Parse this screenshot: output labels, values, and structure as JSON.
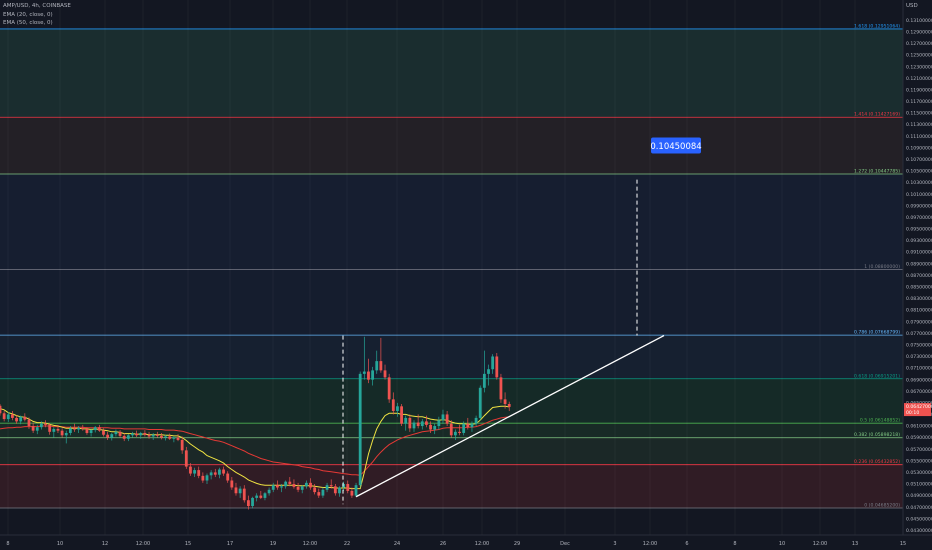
{
  "header": {
    "symbol": "AMP/USD, 4h, COINBASE",
    "ema1": "EMA (20, close, 0)",
    "ema2": "EMA (50, close, 0)"
  },
  "currency": "USD",
  "colors": {
    "background": "#131722",
    "up": "#26a69a",
    "down": "#ef5350",
    "ema20": "#f0e442",
    "ema50": "#e53935",
    "trendline": "#ffffff",
    "callout": "#2962ff"
  },
  "chart_data": {
    "type": "candlestick",
    "y_axis": {
      "scale": "linear",
      "range": [
        0.0422,
        0.1345
      ],
      "ticks": [
        "0.13300000",
        "0.13100000",
        "0.12900000",
        "0.12700000",
        "0.12500000",
        "0.12300000",
        "0.12100000",
        "0.11900000",
        "0.11700000",
        "0.11500000",
        "0.11300000",
        "0.11100000",
        "0.10900000",
        "0.10700000",
        "0.10500000",
        "0.10300000",
        "0.10100000",
        "0.09900000",
        "0.09700000",
        "0.09500000",
        "0.09300000",
        "0.09100000",
        "0.08900000",
        "0.08700000",
        "0.08500000",
        "0.08300000",
        "0.08100000",
        "0.07900000",
        "0.07700000",
        "0.07500000",
        "0.07300000",
        "0.07100000",
        "0.06900000",
        "0.06700000",
        "0.06500000",
        "0.06300000",
        "0.06100000",
        "0.05900000",
        "0.05700000",
        "0.05500000",
        "0.05300000",
        "0.05100000",
        "0.04900000",
        "0.04700000",
        "0.04500000",
        "0.04300000"
      ]
    },
    "x_axis": {
      "tick_labels": [
        "8",
        "10",
        "12",
        "12:00",
        "15",
        "17",
        "19",
        "12:00",
        "22",
        "24",
        "26",
        "12:00",
        "29",
        "Dec",
        "3",
        "12:00",
        "6",
        "8",
        "10",
        "12:00",
        "13",
        "15"
      ]
    },
    "last_price": "0.06427000",
    "countdown": "00:10",
    "fib_levels": [
      {
        "label": "0 (0.04685200)",
        "value": 0.046852,
        "color": "#787b86"
      },
      {
        "label": "0.236 (0.05432852)",
        "value": 0.05432852,
        "color": "#f23645"
      },
      {
        "label": "0.382 (0.05898218)",
        "value": 0.05898218,
        "color": "#81c784"
      },
      {
        "label": "0.5 (0.06148852)",
        "value": 0.06148852,
        "color": "#4caf50"
      },
      {
        "label": "0.618 (0.06915201)",
        "value": 0.06915201,
        "color": "#089981"
      },
      {
        "label": "0.786 (0.07668799)",
        "value": 0.07668799,
        "color": "#64b5f6"
      },
      {
        "label": "1 (0.08800000)",
        "value": 0.088,
        "color": "#787b86"
      },
      {
        "label": "1.272 (0.10447785)",
        "value": 0.10447785,
        "color": "#81c784"
      },
      {
        "label": "1.414 (0.11427169)",
        "value": 0.11427169,
        "color": "#f23645"
      },
      {
        "label": "1.618 (0.12951064)",
        "value": 0.12951064,
        "color": "#2196f3"
      }
    ],
    "target_price": "0.10450084",
    "candles": [
      [
        0.0645,
        0.0648,
        0.0628,
        0.0632
      ],
      [
        0.0632,
        0.0636,
        0.0618,
        0.0622
      ],
      [
        0.0622,
        0.0634,
        0.0617,
        0.063
      ],
      [
        0.063,
        0.0636,
        0.062,
        0.0624
      ],
      [
        0.0624,
        0.0629,
        0.0614,
        0.0618
      ],
      [
        0.0618,
        0.0628,
        0.0613,
        0.0626
      ],
      [
        0.0626,
        0.0632,
        0.0618,
        0.0621
      ],
      [
        0.0621,
        0.0625,
        0.0605,
        0.061
      ],
      [
        0.061,
        0.0616,
        0.0598,
        0.0602
      ],
      [
        0.0602,
        0.0612,
        0.0596,
        0.0608
      ],
      [
        0.0608,
        0.0618,
        0.0604,
        0.0614
      ],
      [
        0.0614,
        0.062,
        0.0608,
        0.0612
      ],
      [
        0.0612,
        0.0615,
        0.0595,
        0.06
      ],
      [
        0.06,
        0.0608,
        0.059,
        0.0605
      ],
      [
        0.0605,
        0.0612,
        0.0598,
        0.0602
      ],
      [
        0.0602,
        0.0606,
        0.059,
        0.0594
      ],
      [
        0.0594,
        0.0602,
        0.058,
        0.0598
      ],
      [
        0.0598,
        0.061,
        0.0594,
        0.0606
      ],
      [
        0.0606,
        0.0614,
        0.06,
        0.0604
      ],
      [
        0.0604,
        0.061,
        0.0598,
        0.0607
      ],
      [
        0.0607,
        0.0612,
        0.0602,
        0.0605
      ],
      [
        0.0605,
        0.0608,
        0.0595,
        0.0598
      ],
      [
        0.0598,
        0.0606,
        0.0592,
        0.0603
      ],
      [
        0.0603,
        0.061,
        0.0599,
        0.0608
      ],
      [
        0.0608,
        0.0612,
        0.06,
        0.0602
      ],
      [
        0.0602,
        0.0606,
        0.0592,
        0.0595
      ],
      [
        0.0595,
        0.06,
        0.0586,
        0.059
      ],
      [
        0.059,
        0.0598,
        0.0585,
        0.0596
      ],
      [
        0.0596,
        0.0604,
        0.0592,
        0.06
      ],
      [
        0.06,
        0.0603,
        0.059,
        0.0593
      ],
      [
        0.0593,
        0.0598,
        0.0584,
        0.0588
      ],
      [
        0.0588,
        0.0596,
        0.0584,
        0.0594
      ],
      [
        0.0594,
        0.06,
        0.059,
        0.0597
      ],
      [
        0.0597,
        0.0602,
        0.0591,
        0.0594
      ],
      [
        0.0594,
        0.06,
        0.0588,
        0.0598
      ],
      [
        0.0598,
        0.0603,
        0.0592,
        0.0595
      ],
      [
        0.0595,
        0.06,
        0.0588,
        0.0592
      ],
      [
        0.0592,
        0.0598,
        0.0586,
        0.0595
      ],
      [
        0.0595,
        0.06,
        0.059,
        0.0593
      ],
      [
        0.0593,
        0.0598,
        0.0587,
        0.059
      ],
      [
        0.059,
        0.0595,
        0.0585,
        0.0592
      ],
      [
        0.0592,
        0.0597,
        0.0586,
        0.0588
      ],
      [
        0.0588,
        0.0593,
        0.0582,
        0.059
      ],
      [
        0.059,
        0.0596,
        0.0584,
        0.0586
      ],
      [
        0.0586,
        0.0592,
        0.0562,
        0.0568
      ],
      [
        0.0568,
        0.0574,
        0.0536,
        0.054
      ],
      [
        0.054,
        0.0546,
        0.0524,
        0.0528
      ],
      [
        0.0528,
        0.0538,
        0.0522,
        0.0534
      ],
      [
        0.0534,
        0.054,
        0.052,
        0.0524
      ],
      [
        0.0524,
        0.053,
        0.0512,
        0.0516
      ],
      [
        0.0516,
        0.0528,
        0.051,
        0.0525
      ],
      [
        0.0525,
        0.0534,
        0.0518,
        0.053
      ],
      [
        0.053,
        0.0536,
        0.0522,
        0.0526
      ],
      [
        0.0526,
        0.0538,
        0.052,
        0.0535
      ],
      [
        0.0535,
        0.054,
        0.0524,
        0.0528
      ],
      [
        0.0528,
        0.0532,
        0.0512,
        0.0516
      ],
      [
        0.0516,
        0.0522,
        0.05,
        0.0504
      ],
      [
        0.0504,
        0.0512,
        0.049,
        0.0494
      ],
      [
        0.0494,
        0.0506,
        0.0486,
        0.0502
      ],
      [
        0.0502,
        0.0508,
        0.0478,
        0.0482
      ],
      [
        0.0482,
        0.049,
        0.0466,
        0.0472
      ],
      [
        0.0472,
        0.0488,
        0.0468,
        0.0486
      ],
      [
        0.0486,
        0.0494,
        0.048,
        0.049
      ],
      [
        0.049,
        0.0498,
        0.0484,
        0.0486
      ],
      [
        0.0486,
        0.0496,
        0.0482,
        0.0494
      ],
      [
        0.0494,
        0.0504,
        0.049,
        0.05
      ],
      [
        0.05,
        0.0512,
        0.0496,
        0.0508
      ],
      [
        0.0508,
        0.0516,
        0.05,
        0.0504
      ],
      [
        0.0504,
        0.051,
        0.0496,
        0.0506
      ],
      [
        0.0506,
        0.0516,
        0.0502,
        0.0514
      ],
      [
        0.0514,
        0.0522,
        0.0506,
        0.051
      ],
      [
        0.051,
        0.0518,
        0.0502,
        0.0505
      ],
      [
        0.0505,
        0.0512,
        0.0496,
        0.05
      ],
      [
        0.05,
        0.0508,
        0.0494,
        0.0506
      ],
      [
        0.0506,
        0.0516,
        0.0502,
        0.0512
      ],
      [
        0.0512,
        0.052,
        0.05,
        0.0504
      ],
      [
        0.0504,
        0.051,
        0.0492,
        0.0496
      ],
      [
        0.0496,
        0.0502,
        0.0486,
        0.049
      ],
      [
        0.049,
        0.0504,
        0.0486,
        0.05
      ],
      [
        0.05,
        0.0512,
        0.0496,
        0.0508
      ],
      [
        0.0508,
        0.0518,
        0.0502,
        0.0506
      ],
      [
        0.0506,
        0.051,
        0.049,
        0.0494
      ],
      [
        0.0494,
        0.0506,
        0.0488,
        0.0504
      ],
      [
        0.0504,
        0.0514,
        0.0498,
        0.051
      ],
      [
        0.051,
        0.0516,
        0.0494,
        0.0498
      ],
      [
        0.0498,
        0.0504,
        0.0486,
        0.049
      ],
      [
        0.049,
        0.0512,
        0.0488,
        0.0508
      ],
      [
        0.0508,
        0.0704,
        0.0504,
        0.07
      ],
      [
        0.07,
        0.0764,
        0.069,
        0.0704
      ],
      [
        0.0704,
        0.0726,
        0.0684,
        0.069
      ],
      [
        0.069,
        0.0712,
        0.068,
        0.0706
      ],
      [
        0.0706,
        0.074,
        0.07,
        0.0722
      ],
      [
        0.0722,
        0.0762,
        0.0702,
        0.0706
      ],
      [
        0.0706,
        0.0716,
        0.069,
        0.0694
      ],
      [
        0.0694,
        0.07,
        0.065,
        0.0656
      ],
      [
        0.0656,
        0.0668,
        0.063,
        0.0636
      ],
      [
        0.0636,
        0.065,
        0.0626,
        0.0644
      ],
      [
        0.0644,
        0.0648,
        0.061,
        0.0614
      ],
      [
        0.0614,
        0.0628,
        0.0602,
        0.0624
      ],
      [
        0.0624,
        0.063,
        0.06,
        0.0606
      ],
      [
        0.0606,
        0.062,
        0.06,
        0.0616
      ],
      [
        0.0616,
        0.063,
        0.0606,
        0.061
      ],
      [
        0.061,
        0.0622,
        0.0604,
        0.0618
      ],
      [
        0.0618,
        0.0628,
        0.0608,
        0.0612
      ],
      [
        0.0612,
        0.0618,
        0.0598,
        0.0604
      ],
      [
        0.0604,
        0.0614,
        0.0596,
        0.061
      ],
      [
        0.061,
        0.0626,
        0.0604,
        0.062
      ],
      [
        0.062,
        0.0638,
        0.0614,
        0.063
      ],
      [
        0.063,
        0.0636,
        0.061,
        0.0614
      ],
      [
        0.0614,
        0.062,
        0.059,
        0.0594
      ],
      [
        0.0594,
        0.0604,
        0.0586,
        0.06
      ],
      [
        0.06,
        0.0612,
        0.0594,
        0.0598
      ],
      [
        0.0598,
        0.0618,
        0.0594,
        0.0614
      ],
      [
        0.0614,
        0.0624,
        0.0604,
        0.0608
      ],
      [
        0.0608,
        0.0618,
        0.06,
        0.0614
      ],
      [
        0.0614,
        0.0628,
        0.061,
        0.0624
      ],
      [
        0.0624,
        0.068,
        0.062,
        0.0676
      ],
      [
        0.0676,
        0.074,
        0.0668,
        0.07
      ],
      [
        0.07,
        0.0716,
        0.068,
        0.0708
      ],
      [
        0.0708,
        0.0734,
        0.07,
        0.073
      ],
      [
        0.073,
        0.0736,
        0.069,
        0.0694
      ],
      [
        0.0694,
        0.07,
        0.065,
        0.0656
      ],
      [
        0.0656,
        0.0668,
        0.064,
        0.0648
      ],
      [
        0.0648,
        0.0652,
        0.0636,
        0.0643
      ]
    ],
    "ema20": [
      0.064,
      0.0638,
      0.0633,
      0.0631,
      0.0628,
      0.0626,
      0.0625,
      0.0622,
      0.0618,
      0.0616,
      0.0616,
      0.0615,
      0.0613,
      0.0611,
      0.061,
      0.0608,
      0.0606,
      0.0606,
      0.0606,
      0.0606,
      0.0605,
      0.0605,
      0.0604,
      0.0605,
      0.0604,
      0.0603,
      0.0602,
      0.06,
      0.06,
      0.0599,
      0.0597,
      0.0597,
      0.0597,
      0.0596,
      0.0596,
      0.0596,
      0.0595,
      0.0595,
      0.0595,
      0.0595,
      0.0594,
      0.0594,
      0.0593,
      0.0593,
      0.059,
      0.0585,
      0.0579,
      0.0574,
      0.0569,
      0.0565,
      0.0559,
      0.0556,
      0.0553,
      0.055,
      0.0546,
      0.054,
      0.0535,
      0.053,
      0.0526,
      0.0522,
      0.0517,
      0.0514,
      0.0511,
      0.0509,
      0.0508,
      0.0508,
      0.0508,
      0.0508,
      0.0508,
      0.0508,
      0.0508,
      0.0508,
      0.0507,
      0.0507,
      0.0507,
      0.0507,
      0.0506,
      0.0505,
      0.0504,
      0.0504,
      0.0504,
      0.0503,
      0.0503,
      0.0503,
      0.0503,
      0.0502,
      0.0502,
      0.0502,
      0.053,
      0.0562,
      0.0585,
      0.0605,
      0.0618,
      0.0628,
      0.0632,
      0.0632,
      0.0632,
      0.063,
      0.063,
      0.0628,
      0.0627,
      0.0626,
      0.0626,
      0.0624,
      0.0622,
      0.0621,
      0.062,
      0.0621,
      0.062,
      0.0617,
      0.0615,
      0.0614,
      0.0614,
      0.0613,
      0.0613,
      0.0614,
      0.062,
      0.0628,
      0.0635,
      0.0642,
      0.0643,
      0.0644,
      0.0644,
      0.0643
    ],
    "ema50": [
      0.0605,
      0.0606,
      0.0607,
      0.0607,
      0.0608,
      0.0608,
      0.0609,
      0.0609,
      0.0609,
      0.0609,
      0.061,
      0.061,
      0.061,
      0.0609,
      0.0609,
      0.0609,
      0.0608,
      0.0608,
      0.0608,
      0.0608,
      0.0608,
      0.0607,
      0.0607,
      0.0607,
      0.0607,
      0.0607,
      0.0607,
      0.0606,
      0.0606,
      0.0606,
      0.0605,
      0.0605,
      0.0605,
      0.0605,
      0.0605,
      0.0605,
      0.0604,
      0.0604,
      0.0604,
      0.0604,
      0.0603,
      0.0603,
      0.0603,
      0.0602,
      0.0601,
      0.0599,
      0.0597,
      0.0595,
      0.0593,
      0.0591,
      0.0589,
      0.0587,
      0.0585,
      0.0584,
      0.0582,
      0.0579,
      0.0576,
      0.0573,
      0.057,
      0.0567,
      0.0563,
      0.056,
      0.0557,
      0.0554,
      0.0552,
      0.055,
      0.0548,
      0.0547,
      0.0546,
      0.0545,
      0.0544,
      0.0543,
      0.0542,
      0.054,
      0.0539,
      0.0538,
      0.0536,
      0.0535,
      0.0533,
      0.0532,
      0.0531,
      0.053,
      0.0529,
      0.0528,
      0.0527,
      0.0526,
      0.0526,
      0.0525,
      0.0532,
      0.054,
      0.0548,
      0.0557,
      0.0565,
      0.0572,
      0.0578,
      0.0582,
      0.0586,
      0.0589,
      0.0592,
      0.0594,
      0.0596,
      0.0598,
      0.06,
      0.0601,
      0.0602,
      0.0603,
      0.0604,
      0.0606,
      0.0607,
      0.0607,
      0.0607,
      0.0607,
      0.0607,
      0.0608,
      0.0608,
      0.0609,
      0.0611,
      0.0614,
      0.0617,
      0.062,
      0.0622,
      0.0624,
      0.0625,
      0.0626
    ]
  }
}
